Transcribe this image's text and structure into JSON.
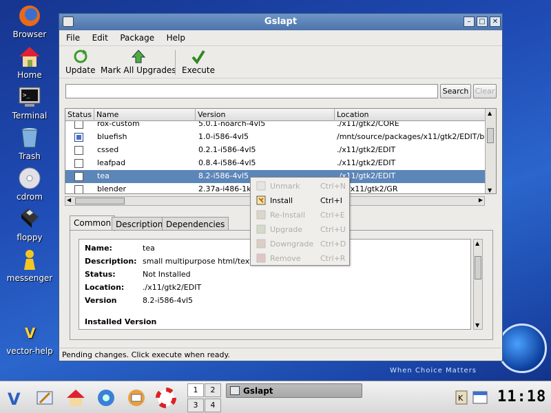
{
  "desktop": {
    "icons": [
      {
        "label": "Browser"
      },
      {
        "label": "Home"
      },
      {
        "label": "Terminal"
      },
      {
        "label": "Trash"
      },
      {
        "label": "cdrom"
      },
      {
        "label": "floppy"
      },
      {
        "label": "messenger"
      },
      {
        "label": "vector-help"
      }
    ],
    "watermark_tagline": "When Choice Matters"
  },
  "window": {
    "title": "Gslapt",
    "menu": [
      "File",
      "Edit",
      "Package",
      "Help"
    ],
    "toolbar": {
      "update_label": "Update",
      "mark_all_upgrades_label": "Mark All Upgrades",
      "execute_label": "Execute"
    },
    "search": {
      "value": "",
      "button": "Search",
      "clear": "Clear"
    },
    "table": {
      "columns": [
        "Status",
        "Name",
        "Version",
        "Location"
      ],
      "rows": [
        {
          "installed": false,
          "name": "rox-custom",
          "version": "5.0.1-noarch-4vl5",
          "location": "./x11/gtk2/CORE"
        },
        {
          "installed": true,
          "name": "bluefish",
          "version": "1.0-i586-4vl5",
          "location": "/mnt/source/packages/x11/gtk2/EDIT/b"
        },
        {
          "installed": false,
          "name": "cssed",
          "version": "0.2.1-i586-4vl5",
          "location": "./x11/gtk2/EDIT"
        },
        {
          "installed": false,
          "name": "leafpad",
          "version": "0.8.4-i586-4vl5",
          "location": "./x11/gtk2/EDIT"
        },
        {
          "installed": false,
          "name": "tea",
          "version": "8.2-i586-4vl5",
          "location": "./x11/gtk2/EDIT",
          "selected": true
        },
        {
          "installed": false,
          "name": "blender",
          "version": "2.37a-i486-1k",
          "location": "/x11/gtk2/GR"
        }
      ]
    },
    "tabs": [
      "Common",
      "Description",
      "Dependencies"
    ],
    "details": {
      "name_label": "Name:",
      "name": "tea",
      "description_label": "Description:",
      "description": "small multipurpose html/text",
      "status_label": "Status:",
      "status": "Not Installed",
      "location_label": "Location:",
      "location": "./x11/gtk2/EDIT",
      "version_label": "Version",
      "version": "8.2-i586-4vl5",
      "installed_version_heading": "Installed Version"
    },
    "statusbar": "Pending changes. Click execute when ready."
  },
  "context_menu": [
    {
      "label": "Unmark",
      "accel": "Ctrl+N",
      "enabled": false
    },
    {
      "label": "Install",
      "accel": "Ctrl+I",
      "enabled": true
    },
    {
      "label": "Re-Install",
      "accel": "Ctrl+E",
      "enabled": false
    },
    {
      "label": "Upgrade",
      "accel": "Ctrl+U",
      "enabled": false
    },
    {
      "label": "Downgrade",
      "accel": "Ctrl+D",
      "enabled": false
    },
    {
      "label": "Remove",
      "accel": "Ctrl+R",
      "enabled": false
    }
  ],
  "taskbar": {
    "pager": [
      "1",
      "2",
      "3",
      "4"
    ],
    "task_label": "Gslapt",
    "clock": "11:18"
  }
}
